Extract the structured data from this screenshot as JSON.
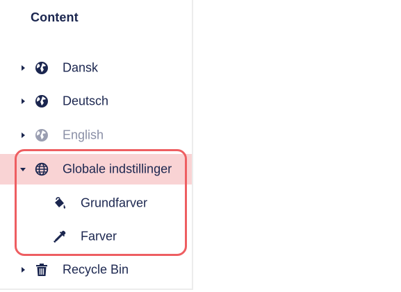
{
  "panel": {
    "title": "Content"
  },
  "tree": {
    "items": [
      {
        "label": "Dansk",
        "icon": "globe-icon",
        "state": "collapsed"
      },
      {
        "label": "Deutsch",
        "icon": "globe-icon",
        "state": "collapsed"
      },
      {
        "label": "English",
        "icon": "globe-icon",
        "state": "collapsed",
        "muted": true
      },
      {
        "label": "Globale indstillinger",
        "icon": "grid-globe-icon",
        "state": "expanded",
        "selected": true
      },
      {
        "label": "Grundfarver",
        "icon": "paint-bucket-icon",
        "state": "leaf"
      },
      {
        "label": "Farver",
        "icon": "eyedropper-icon",
        "state": "leaf"
      },
      {
        "label": "Recycle Bin",
        "icon": "trash-icon",
        "state": "collapsed"
      }
    ]
  },
  "colors": {
    "text": "#1b264f",
    "muted_text": "#8a8fa6",
    "selected_background": "#f9d3d4",
    "highlight_border": "#ee5e61"
  }
}
